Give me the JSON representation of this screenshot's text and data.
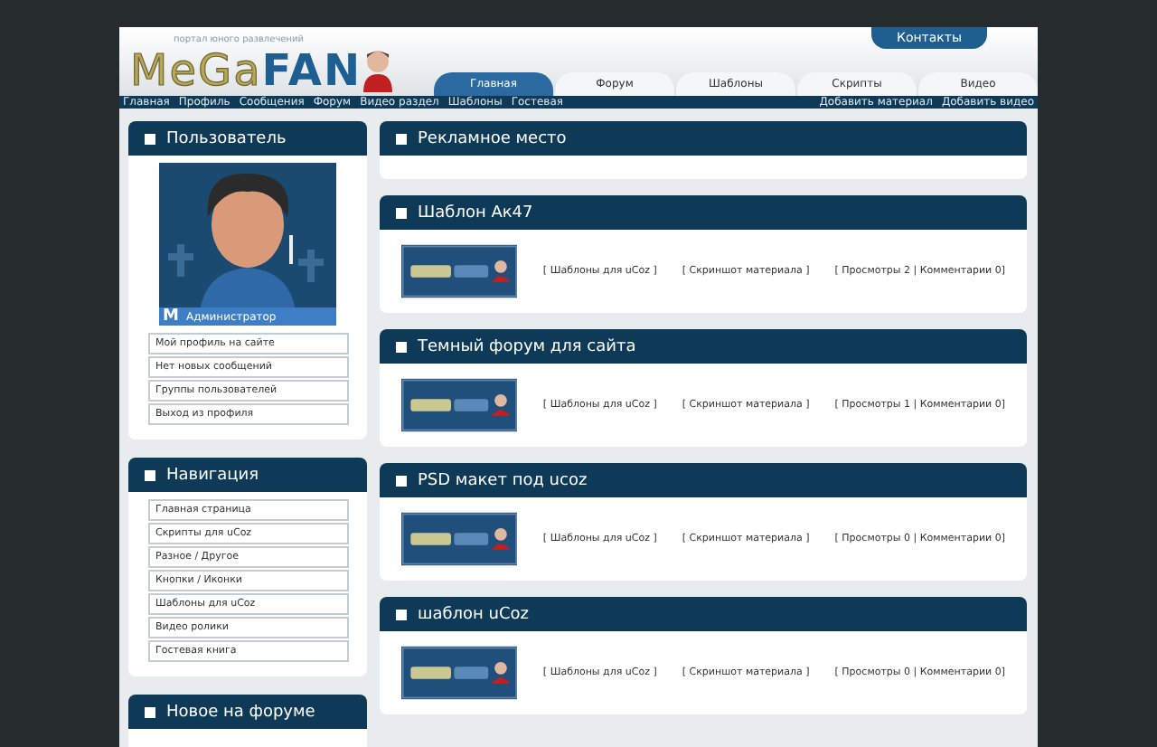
{
  "header": {
    "contact_tab": "Контакты",
    "logo": {
      "tagline": "портал юного развлечений",
      "name_part_1": "MeGa",
      "name_part_2": "FAN"
    },
    "tabs": [
      {
        "label": "Главная",
        "selected": true
      },
      {
        "label": "Форум",
        "selected": false
      },
      {
        "label": "Шаблоны",
        "selected": false
      },
      {
        "label": "Скрипты",
        "selected": false
      },
      {
        "label": "Видео",
        "selected": false
      }
    ]
  },
  "nav_bar": {
    "left_links": [
      "Главная",
      "Профиль",
      "Сообщения",
      "Форум",
      "Видео раздел",
      "Шаблоны",
      "Гостевая"
    ],
    "right_links": [
      "Добавить материал",
      "Добавить видео"
    ]
  },
  "sidebar": [
    {
      "kind": "user",
      "title": "Пользователь",
      "avatar": {
        "kind": "picture",
        "badge": "M",
        "caption": "Администратор"
      },
      "links": [
        "Мой профиль на сайте",
        "Нет новых сообщений",
        "Группы пользователей",
        "Выход из профиля"
      ]
    },
    {
      "kind": "links",
      "title": "Навигация",
      "links": [
        "Главная страница",
        "Скрипты для uCoz",
        "Разное / Другое",
        "Кнопки / Иконки",
        "Шаблоны для uCoz",
        "Видео ролики",
        "Гостевая книга"
      ]
    },
    {
      "kind": "links",
      "title": "Новое на форуме"
    }
  ],
  "main": [
    {
      "kind": "empty",
      "title": "Рекламное место"
    },
    {
      "kind": "entry",
      "title": "Шаблон Ак47",
      "category": "[ Шаблоны для uCoz ]",
      "screenshot": "[ Скриншот материала ]",
      "stats": "[ Просмотры 2 | Комментарии 0]"
    },
    {
      "kind": "entry",
      "title": "Темный форум для сайта",
      "category": "[ Шаблоны для uCoz ]",
      "screenshot": "[ Скриншот материала ]",
      "stats": "[ Просмотры 1 | Комментарии 0]"
    },
    {
      "kind": "entry",
      "title": "PSD макет под ucoz",
      "category": "[ Шаблоны для uCoz ]",
      "screenshot": "[ Скриншот материала ]",
      "stats": "[ Просмотры 0 | Комментарии 0]"
    },
    {
      "kind": "entry",
      "title": "шаблон uCoz",
      "category": "[ Шаблоны для uCoz ]",
      "screenshot": "[ Скриншот материала ]",
      "stats": "[ Просмотры 0 | Комментарии 0]"
    }
  ]
}
